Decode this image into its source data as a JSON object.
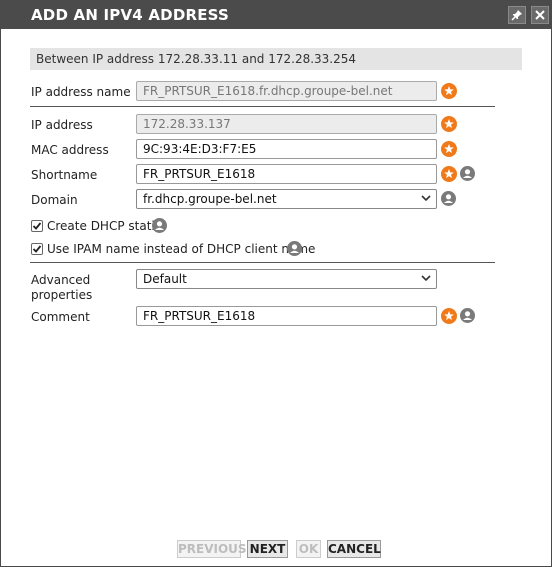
{
  "window": {
    "title": "ADD AN IPV4 ADDRESS",
    "pin_icon": "pin-icon",
    "close_icon": "close-icon"
  },
  "info_text": "Between IP address 172.28.33.11 and 172.28.33.254",
  "form": {
    "ip_address_name": {
      "label": "IP address name",
      "value": "FR_PRTSUR_E1618.fr.dhcp.groupe-bel.net"
    },
    "ip_address": {
      "label": "IP address",
      "value": "172.28.33.137"
    },
    "mac_address": {
      "label": "MAC address",
      "value": "9C:93:4E:D3:F7:E5"
    },
    "shortname": {
      "label": "Shortname",
      "value": "FR_PRTSUR_E1618"
    },
    "domain": {
      "label": "Domain",
      "value": "fr.dhcp.groupe-bel.net"
    },
    "create_dhcp_static": {
      "label": "Create DHCP static",
      "checked": true
    },
    "use_ipam_name": {
      "label": "Use IPAM name instead of DHCP client name",
      "checked": true
    },
    "advanced_properties": {
      "label_line1": "Advanced",
      "label_line2": "properties",
      "value": "Default"
    },
    "comment": {
      "label": "Comment",
      "value": "FR_PRTSUR_E1618"
    }
  },
  "buttons": {
    "previous": {
      "label": "PREVIOUS",
      "enabled": false
    },
    "next": {
      "label": "NEXT",
      "enabled": true
    },
    "ok": {
      "label": "OK",
      "enabled": false
    },
    "cancel": {
      "label": "CANCEL",
      "enabled": true
    }
  },
  "colors": {
    "titlebar": "#4b4b4b",
    "required_star": "#f07a1a",
    "user_icon": "#7a7a7a"
  }
}
